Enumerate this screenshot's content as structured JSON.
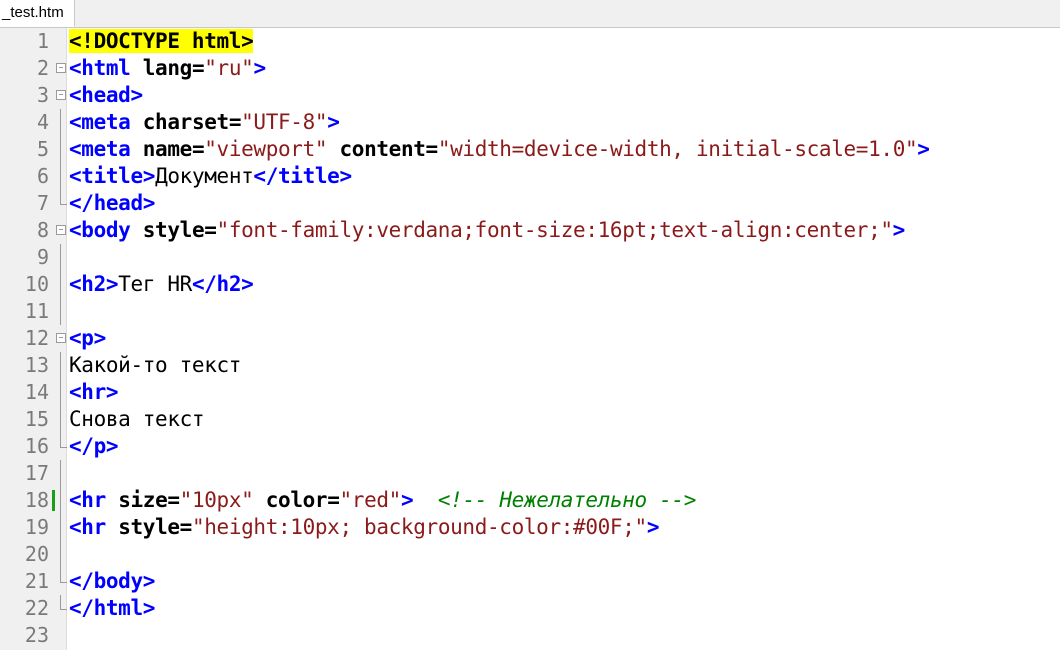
{
  "tab": {
    "title": "_test.htm"
  },
  "lines": [
    {
      "num": "1",
      "tokens": [
        {
          "t": "doctype",
          "v": "<!DOCTYPE html>"
        }
      ]
    },
    {
      "num": "2",
      "fold": "open",
      "tokens": [
        {
          "t": "tag",
          "v": "<html"
        },
        {
          "t": "txt",
          "v": " "
        },
        {
          "t": "attr",
          "v": "lang"
        },
        {
          "t": "op",
          "v": "="
        },
        {
          "t": "val",
          "v": "\"ru\""
        },
        {
          "t": "tag",
          "v": ">"
        }
      ]
    },
    {
      "num": "3",
      "fold": "open",
      "tokens": [
        {
          "t": "tag",
          "v": "<head"
        },
        {
          "t": "tag",
          "v": ">"
        }
      ]
    },
    {
      "num": "4",
      "fold": "line",
      "tokens": [
        {
          "t": "tag",
          "v": "<meta"
        },
        {
          "t": "txt",
          "v": " "
        },
        {
          "t": "attr",
          "v": "charset"
        },
        {
          "t": "op",
          "v": "="
        },
        {
          "t": "val",
          "v": "\"UTF-8\""
        },
        {
          "t": "tag",
          "v": ">"
        }
      ]
    },
    {
      "num": "5",
      "fold": "line",
      "tokens": [
        {
          "t": "tag",
          "v": "<meta"
        },
        {
          "t": "txt",
          "v": " "
        },
        {
          "t": "attr",
          "v": "name"
        },
        {
          "t": "op",
          "v": "="
        },
        {
          "t": "val",
          "v": "\"viewport\""
        },
        {
          "t": "txt",
          "v": " "
        },
        {
          "t": "attr",
          "v": "content"
        },
        {
          "t": "op",
          "v": "="
        },
        {
          "t": "val",
          "v": "\"width=device-width, initial-scale=1.0\""
        },
        {
          "t": "tag",
          "v": ">"
        }
      ]
    },
    {
      "num": "6",
      "fold": "line",
      "tokens": [
        {
          "t": "tag",
          "v": "<title>"
        },
        {
          "t": "txt",
          "v": "Документ"
        },
        {
          "t": "tag",
          "v": "</title>"
        }
      ]
    },
    {
      "num": "7",
      "fold": "end",
      "tokens": [
        {
          "t": "tag",
          "v": "</head>"
        }
      ]
    },
    {
      "num": "8",
      "fold": "open",
      "tokens": [
        {
          "t": "tag",
          "v": "<body"
        },
        {
          "t": "txt",
          "v": " "
        },
        {
          "t": "attr",
          "v": "style"
        },
        {
          "t": "op",
          "v": "="
        },
        {
          "t": "val",
          "v": "\"font-family:verdana;font-size:16pt;text-align:center;\""
        },
        {
          "t": "tag",
          "v": ">"
        }
      ]
    },
    {
      "num": "9",
      "fold": "line",
      "tokens": []
    },
    {
      "num": "10",
      "fold": "line",
      "tokens": [
        {
          "t": "tag",
          "v": "<h2>"
        },
        {
          "t": "txt",
          "v": "Тег HR"
        },
        {
          "t": "tag",
          "v": "</h2>"
        }
      ]
    },
    {
      "num": "11",
      "fold": "line",
      "tokens": []
    },
    {
      "num": "12",
      "fold": "open",
      "tokens": [
        {
          "t": "tag",
          "v": "<p>"
        }
      ]
    },
    {
      "num": "13",
      "fold": "line",
      "tokens": [
        {
          "t": "txt",
          "v": "Какой-то текст"
        }
      ]
    },
    {
      "num": "14",
      "fold": "line",
      "tokens": [
        {
          "t": "tag",
          "v": "<hr>"
        }
      ]
    },
    {
      "num": "15",
      "fold": "line",
      "tokens": [
        {
          "t": "txt",
          "v": "Снова текст"
        }
      ]
    },
    {
      "num": "16",
      "fold": "end",
      "tokens": [
        {
          "t": "tag",
          "v": "</p>"
        }
      ]
    },
    {
      "num": "17",
      "fold": "line",
      "tokens": []
    },
    {
      "num": "18",
      "fold": "line",
      "changed": true,
      "tokens": [
        {
          "t": "tag",
          "v": "<hr"
        },
        {
          "t": "txt",
          "v": " "
        },
        {
          "t": "attr",
          "v": "size"
        },
        {
          "t": "op",
          "v": "="
        },
        {
          "t": "val",
          "v": "\"10px\""
        },
        {
          "t": "txt",
          "v": " "
        },
        {
          "t": "attr",
          "v": "color"
        },
        {
          "t": "op",
          "v": "="
        },
        {
          "t": "val",
          "v": "\"red\""
        },
        {
          "t": "tag",
          "v": ">"
        },
        {
          "t": "txt",
          "v": "  "
        },
        {
          "t": "comment",
          "v": "<!-- Нежелательно -->"
        }
      ]
    },
    {
      "num": "19",
      "fold": "line",
      "tokens": [
        {
          "t": "tag",
          "v": "<hr"
        },
        {
          "t": "txt",
          "v": " "
        },
        {
          "t": "attr",
          "v": "style"
        },
        {
          "t": "op",
          "v": "="
        },
        {
          "t": "val",
          "v": "\"height:10px; background-color:#00F;\""
        },
        {
          "t": "tag",
          "v": ">"
        }
      ]
    },
    {
      "num": "20",
      "fold": "line",
      "tokens": []
    },
    {
      "num": "21",
      "fold": "end",
      "tokens": [
        {
          "t": "tag",
          "v": "</body>"
        }
      ]
    },
    {
      "num": "22",
      "fold": "end",
      "tokens": [
        {
          "t": "tag",
          "v": "</html>"
        }
      ]
    },
    {
      "num": "23",
      "tokens": []
    }
  ],
  "colors": {
    "tag": "#0000ff",
    "attribute_value": "#8b1a1a",
    "comment": "#008000",
    "doctype_highlight": "#ffff00",
    "change_marker": "#18a018"
  }
}
